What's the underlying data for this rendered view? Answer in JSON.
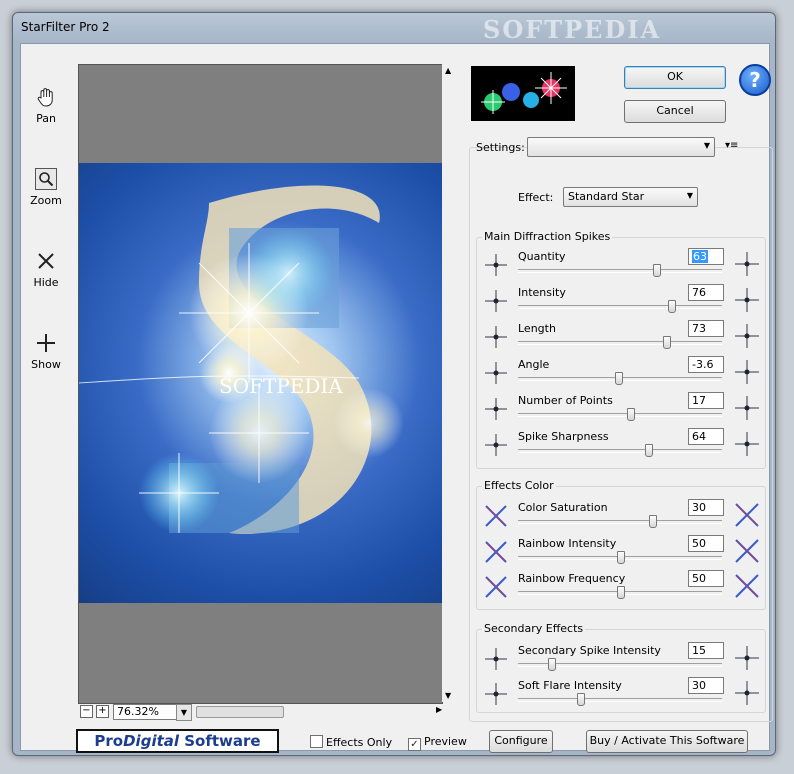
{
  "window": {
    "title": "StarFilter Pro 2",
    "watermark": "SOFTPEDIA"
  },
  "tools": [
    {
      "name": "pan",
      "label": "Pan",
      "icon": "hand-icon"
    },
    {
      "name": "zoom",
      "label": "Zoom",
      "icon": "magnifier-icon"
    },
    {
      "name": "hide",
      "label": "Hide",
      "icon": "x-icon"
    },
    {
      "name": "show",
      "label": "Show",
      "icon": "plus-icon"
    }
  ],
  "preview": {
    "zoom_value": "76.32%",
    "minus": "−",
    "plus": "+",
    "photo_text": "SOFTPEDIA"
  },
  "buttons": {
    "ok": "OK",
    "cancel": "Cancel",
    "help": "?",
    "configure": "Configure",
    "buy": "Buy / Activate This Software"
  },
  "settings": {
    "label": "Settings:",
    "value": "",
    "menu_icon": "▾≡"
  },
  "effect": {
    "label": "Effect:",
    "value": "Standard Star"
  },
  "main_spikes": {
    "title": "Main Diffraction Spikes",
    "rows": [
      {
        "label": "Quantity",
        "value": "63",
        "slider": 0.68
      },
      {
        "label": "Intensity",
        "value": "76",
        "slider": 0.76
      },
      {
        "label": "Length",
        "value": "73",
        "slider": 0.73
      },
      {
        "label": "Angle",
        "value": "-3.6",
        "slider": 0.49
      },
      {
        "label": "Number of Points",
        "value": "17",
        "slider": 0.55
      },
      {
        "label": "Spike Sharpness",
        "value": "64",
        "slider": 0.64
      }
    ]
  },
  "effects_color": {
    "title": "Effects Color",
    "rows": [
      {
        "label": "Color Saturation",
        "value": "30",
        "slider": 0.66
      },
      {
        "label": "Rainbow Intensity",
        "value": "50",
        "slider": 0.5
      },
      {
        "label": "Rainbow Frequency",
        "value": "50",
        "slider": 0.5
      }
    ]
  },
  "secondary": {
    "title": "Secondary Effects",
    "rows": [
      {
        "label": "Secondary Spike Intensity",
        "value": "15",
        "slider": 0.15
      },
      {
        "label": "Soft Flare Intensity",
        "value": "30",
        "slider": 0.3
      }
    ]
  },
  "footer": {
    "logo_pro": "Pro",
    "logo_digital": "Digital",
    "logo_software": " Software",
    "effects_only": "Effects Only",
    "preview": "Preview",
    "effects_only_checked": false,
    "preview_checked": true
  },
  "colors": {
    "accent": "#3399ff",
    "logo_text": "#1d3e8f",
    "photo_blue": "#1d4fa8"
  }
}
